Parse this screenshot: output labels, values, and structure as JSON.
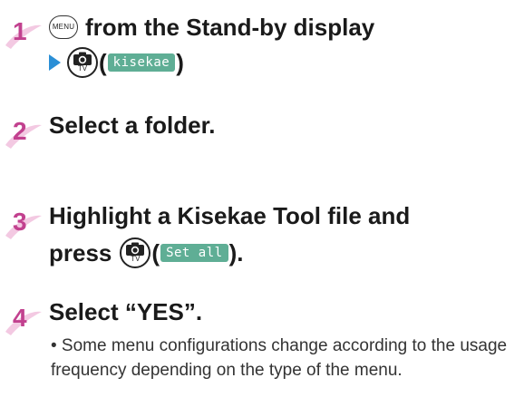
{
  "steps": [
    {
      "number": "1",
      "line1": {
        "menu_key": "MENU",
        "text": "from the Stand-by display"
      },
      "line2": {
        "arrow_icon": "right-arrow-icon",
        "camera_key_label": "TV",
        "paren_open": "(",
        "softkey": "kisekae",
        "paren_close": ")"
      }
    },
    {
      "number": "2",
      "text": "Select a folder."
    },
    {
      "number": "3",
      "line1": "Highlight a Kisekae Tool file and",
      "line2": {
        "text": "press",
        "camera_key_label": "TV",
        "paren_open": "(",
        "softkey": "Set all",
        "paren_close": ")."
      }
    },
    {
      "number": "4",
      "text": "Select “YES”."
    }
  ],
  "note": "• Some menu configurations change according to the usage frequency depending on the type of the menu.",
  "colors": {
    "step_number": "#c2418f",
    "step_badge_bg": "#f3c9e2",
    "softkey_bg": "#5fae95",
    "arrow": "#2b8fd6"
  }
}
